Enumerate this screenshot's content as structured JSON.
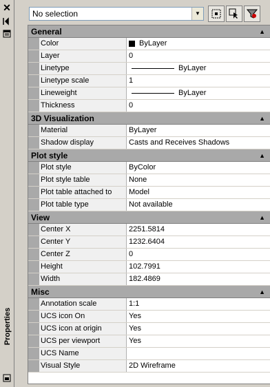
{
  "sidebar": {
    "title": "Properties"
  },
  "toolbar": {
    "selection": "No selection"
  },
  "categories": [
    {
      "name": "General",
      "rows": [
        {
          "label": "Color",
          "value": "ByLayer"
        },
        {
          "label": "Layer",
          "value": "0"
        },
        {
          "label": "Linetype",
          "value": "ByLayer"
        },
        {
          "label": "Linetype scale",
          "value": "1"
        },
        {
          "label": "Lineweight",
          "value": "ByLayer"
        },
        {
          "label": "Thickness",
          "value": "0"
        }
      ]
    },
    {
      "name": "3D Visualization",
      "rows": [
        {
          "label": "Material",
          "value": "ByLayer"
        },
        {
          "label": "Shadow display",
          "value": "Casts and Receives Shadows"
        }
      ]
    },
    {
      "name": "Plot style",
      "rows": [
        {
          "label": "Plot style",
          "value": "ByColor"
        },
        {
          "label": "Plot style table",
          "value": "None"
        },
        {
          "label": "Plot table attached to",
          "value": "Model"
        },
        {
          "label": "Plot table type",
          "value": "Not available"
        }
      ]
    },
    {
      "name": "View",
      "rows": [
        {
          "label": "Center X",
          "value": "2251.5814"
        },
        {
          "label": "Center Y",
          "value": "1232.6404"
        },
        {
          "label": "Center Z",
          "value": "0"
        },
        {
          "label": "Height",
          "value": "102.7991"
        },
        {
          "label": "Width",
          "value": "182.4869"
        }
      ]
    },
    {
      "name": "Misc",
      "rows": [
        {
          "label": "Annotation scale",
          "value": "1:1"
        },
        {
          "label": "UCS icon On",
          "value": "Yes"
        },
        {
          "label": "UCS icon at origin",
          "value": "Yes"
        },
        {
          "label": "UCS per viewport",
          "value": "Yes"
        },
        {
          "label": "UCS Name",
          "value": ""
        },
        {
          "label": "Visual Style",
          "value": "2D Wireframe"
        }
      ]
    }
  ],
  "colors": {
    "category_bg": "#a9a9a9",
    "label_bg": "#f0f0f0",
    "panel_bg": "#d4d0c8"
  }
}
